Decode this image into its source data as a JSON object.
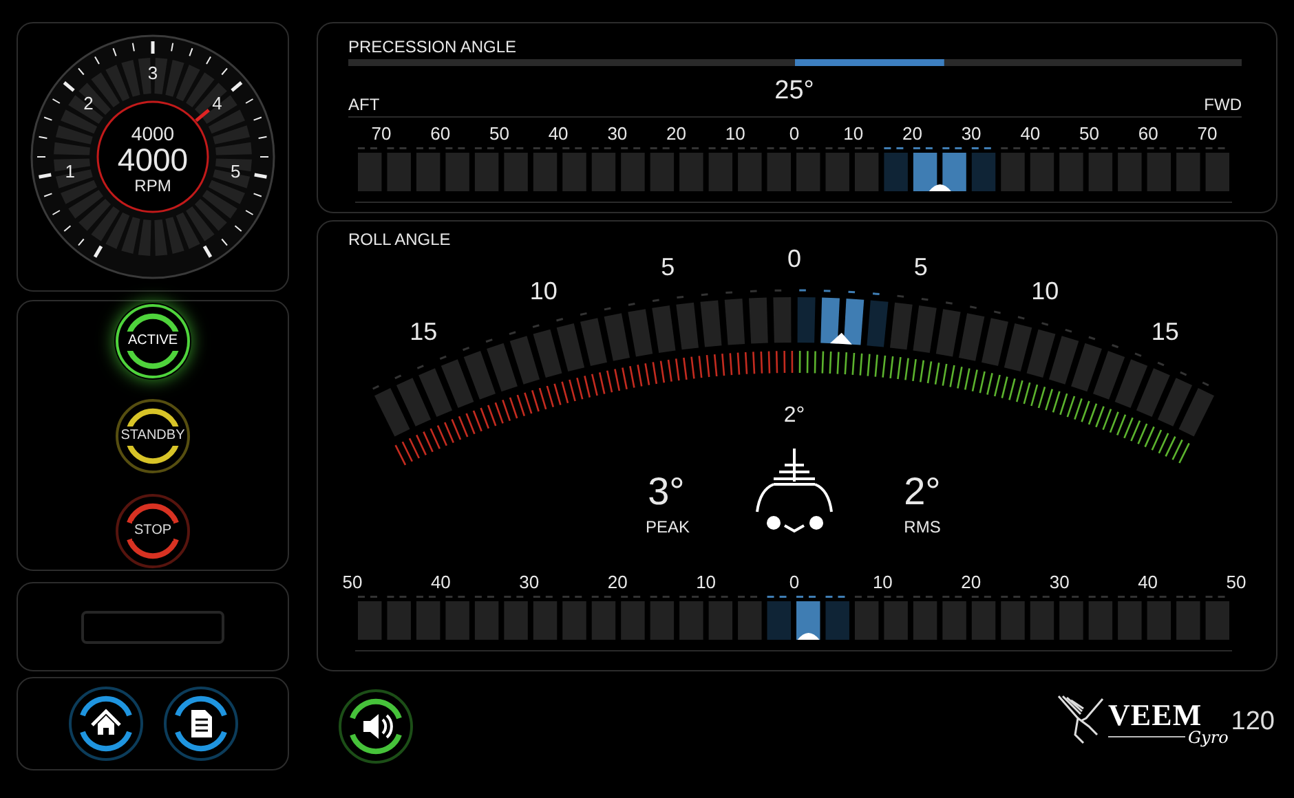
{
  "rpm_gauge": {
    "ticks": [
      "1",
      "2",
      "3",
      "4",
      "5"
    ],
    "setpoint": "4000",
    "reading": "4000",
    "unit": "RPM",
    "level": 0.667
  },
  "mode_buttons": [
    {
      "label": "ACTIVE",
      "color": "#4fd33c",
      "selected": true
    },
    {
      "label": "STANDBY",
      "color": "#d8c428",
      "selected": false
    },
    {
      "label": "STOP",
      "color": "#d83222",
      "selected": false
    }
  ],
  "nav_buttons": [
    {
      "kind": "home",
      "color": "#1f95e0"
    },
    {
      "kind": "document",
      "color": "#1f95e0"
    },
    {
      "kind": "sound",
      "color": "#46c23a"
    }
  ],
  "precession": {
    "title": "PRECESSION ANGLE",
    "reading": "25°",
    "left_label": "AFT",
    "right_label": "FWD",
    "scale": [
      "70",
      "60",
      "50",
      "40",
      "30",
      "20",
      "10",
      "0",
      "10",
      "20",
      "30",
      "40",
      "50",
      "60",
      "70"
    ],
    "level": 0.667
  },
  "roll": {
    "title": "ROLL ANGLE",
    "arc_scale": [
      "15",
      "10",
      "5",
      "0",
      "5",
      "10",
      "15"
    ],
    "arc_pointer": {
      "level": 0.556
    },
    "reading": "2°",
    "peak": {
      "value": "3°",
      "label": "PEAK"
    },
    "rms": {
      "value": "2°",
      "label": "RMS"
    },
    "scale": [
      "50",
      "40",
      "30",
      "20",
      "10",
      "0",
      "10",
      "20",
      "30",
      "40",
      "50"
    ],
    "level": 0.517
  },
  "logo": {
    "brand": "VEEM",
    "sub": "Gyro",
    "model": "120"
  }
}
